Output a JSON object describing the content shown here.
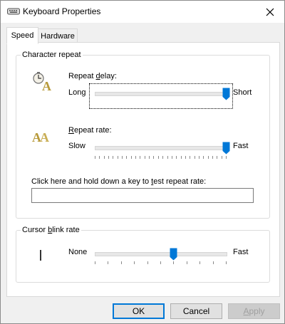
{
  "window": {
    "title": "Keyboard Properties",
    "close_glyph": "✕"
  },
  "tabs": [
    {
      "label": "Speed",
      "active": true
    },
    {
      "label": "Hardware",
      "active": false
    }
  ],
  "character_repeat": {
    "group_label": "Character repeat",
    "repeat_delay": {
      "label_before": "Repeat ",
      "label_underlined": "d",
      "label_after": "elay:",
      "min_label": "Long",
      "max_label": "Short",
      "value_fraction": 1.0,
      "icon": "clock-letter-a-icon"
    },
    "repeat_rate": {
      "label_underlined": "R",
      "label_after": "epeat rate:",
      "min_label": "Slow",
      "max_label": "Fast",
      "value_fraction": 1.0,
      "icon": "double-letter-a-icon"
    },
    "test": {
      "label_before": "Click here and hold down a key to ",
      "label_underlined": "t",
      "label_after": "est repeat rate:",
      "value": ""
    }
  },
  "cursor_blink": {
    "label_before": "Cursor ",
    "label_underlined": "b",
    "label_after": "link rate",
    "min_label": "None",
    "max_label": "Fast",
    "value_fraction": 0.6,
    "icon": "text-cursor-icon"
  },
  "buttons": {
    "ok": "OK",
    "cancel": "Cancel",
    "apply_underlined": "A",
    "apply_after": "pply"
  },
  "colors": {
    "accent": "#0078d7",
    "window_bg": "#f0f0f0",
    "panel_bg": "#ffffff"
  }
}
